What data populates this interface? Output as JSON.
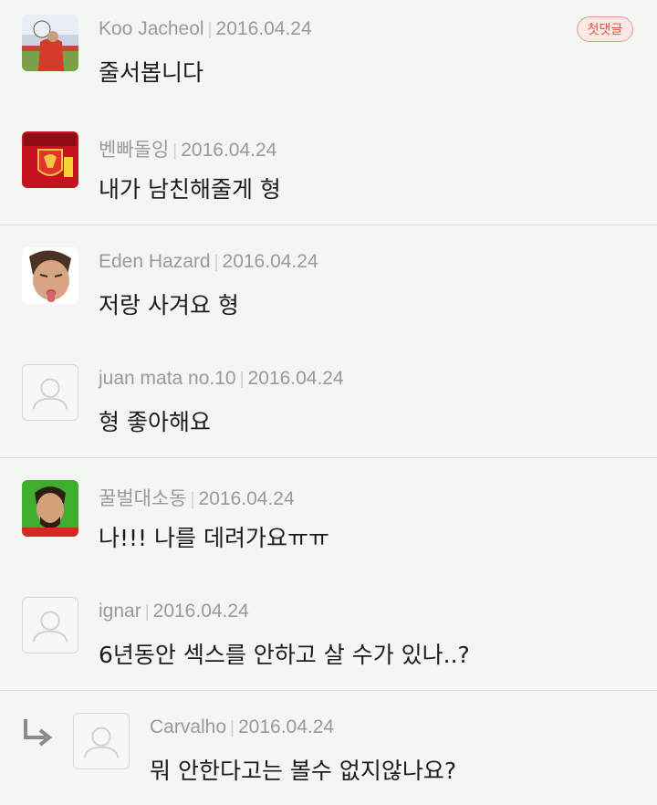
{
  "comments": [
    {
      "author": "Koo Jacheol",
      "date": "2016.04.24",
      "text": "줄서봅니다",
      "badge": "첫댓글",
      "avatar": "photo-player"
    },
    {
      "author": "벤빠돌잉",
      "date": "2016.04.24",
      "text": "내가 남친해줄게 형",
      "avatar": "liverpool-badge"
    },
    {
      "author": "Eden Hazard",
      "date": "2016.04.24",
      "text": "저랑 사겨요 형",
      "avatar": "photo-face"
    },
    {
      "author": "juan mata no.10",
      "date": "2016.04.24",
      "text": "형 좋아해요",
      "avatar": "default-user"
    },
    {
      "author": "꿀벌대소동",
      "date": "2016.04.24",
      "text": "나!!! 나를 데려가요ㅠㅠ",
      "avatar": "photo-face-green"
    },
    {
      "author": "ignar",
      "date": "2016.04.24",
      "text": "6년동안 섹스를 안하고 살 수가 있나..?",
      "avatar": "default-user"
    },
    {
      "author": "Carvalho",
      "date": "2016.04.24",
      "text": "뭐 안한다고는 볼수 없지않나요?",
      "avatar": "default-user",
      "reply": true
    }
  ],
  "icons": {
    "reply": "reply-arrow-icon",
    "default_avatar": "user-silhouette-icon"
  },
  "colors": {
    "background": "#f3f6f3",
    "meta": "#9a9a9a",
    "badge_text": "#d4564b",
    "badge_border": "#e79a94"
  }
}
